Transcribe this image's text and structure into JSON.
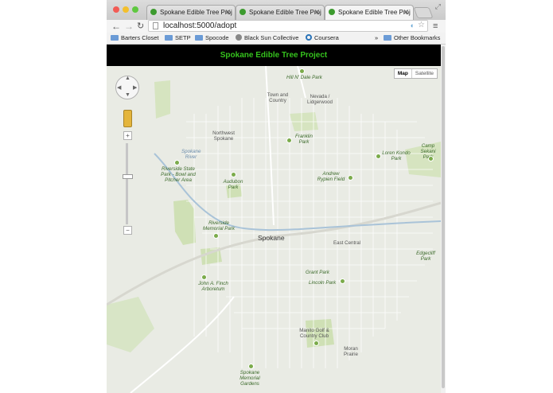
{
  "browser": {
    "tabs": [
      {
        "label": "Spokane Edible Tree Proj"
      },
      {
        "label": "Spokane Edible Tree Proj"
      },
      {
        "label": "Spokane Edible Tree Proj"
      }
    ],
    "url": "localhost:5000/adopt",
    "bookmarks": [
      {
        "label": "Barters Closet"
      },
      {
        "label": "SETP"
      },
      {
        "label": "Spocode"
      },
      {
        "label": "Black Sun Collective"
      },
      {
        "label": "Coursera"
      },
      {
        "label": "Other Bookmarks"
      }
    ]
  },
  "page": {
    "title": "Spokane Edible Tree Project"
  },
  "map": {
    "type_buttons": {
      "map": "Map",
      "satellite": "Satellite"
    },
    "zoom_in": "+",
    "zoom_out": "−",
    "places": [
      {
        "name": "Hill N' Dale Park",
        "kind": "park"
      },
      {
        "name": "Town and Country",
        "kind": "area"
      },
      {
        "name": "Nevada / Lidgerwood",
        "kind": "area"
      },
      {
        "name": "Northwest Spokane",
        "kind": "area"
      },
      {
        "name": "Franklin Park",
        "kind": "park"
      },
      {
        "name": "Camp Sekani Park",
        "kind": "park"
      },
      {
        "name": "Spokane River",
        "kind": "water"
      },
      {
        "name": "Loren Kondo Park",
        "kind": "park"
      },
      {
        "name": "Riverside State Park - Bowl and Pitcher Area",
        "kind": "park"
      },
      {
        "name": "Audubon Park",
        "kind": "park"
      },
      {
        "name": "Andrew Rypien Field",
        "kind": "park"
      },
      {
        "name": "Riverside Memorial Park",
        "kind": "park"
      },
      {
        "name": "Spokane",
        "kind": "city"
      },
      {
        "name": "East Central",
        "kind": "area"
      },
      {
        "name": "Edgecliff Park",
        "kind": "park"
      },
      {
        "name": "Grant Park",
        "kind": "park"
      },
      {
        "name": "John A. Finch Arboretum",
        "kind": "park"
      },
      {
        "name": "Lincoln Park",
        "kind": "park"
      },
      {
        "name": "Manito Golf & Country Club",
        "kind": "park"
      },
      {
        "name": "Moran Prairie",
        "kind": "area"
      },
      {
        "name": "Spokane Memorial Gardens",
        "kind": "park"
      }
    ],
    "colors": {
      "land": "#e9ebe4",
      "park": "#cfe0b5",
      "road": "#ffffff",
      "highway": "#d7d7cf",
      "water": "#a9c3d8",
      "header_text": "#35c21d"
    }
  }
}
